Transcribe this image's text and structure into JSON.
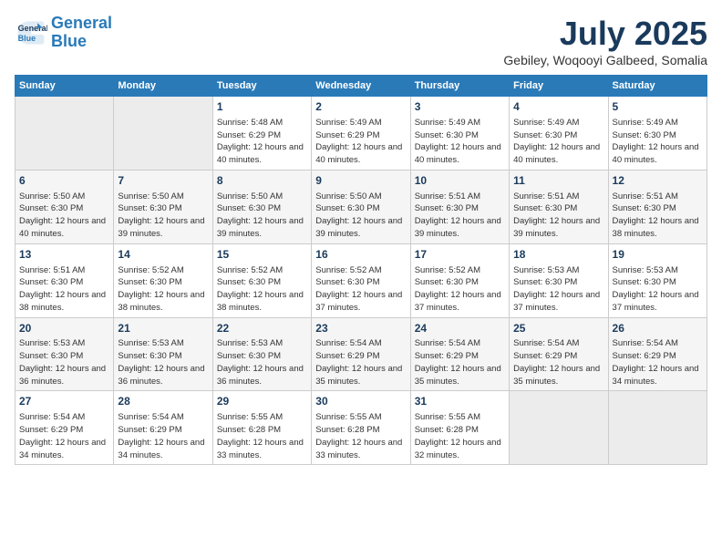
{
  "header": {
    "logo_line1": "General",
    "logo_line2": "Blue",
    "month": "July 2025",
    "location": "Gebiley, Woqooyi Galbeed, Somalia"
  },
  "weekdays": [
    "Sunday",
    "Monday",
    "Tuesday",
    "Wednesday",
    "Thursday",
    "Friday",
    "Saturday"
  ],
  "weeks": [
    [
      {
        "day": "",
        "info": ""
      },
      {
        "day": "",
        "info": ""
      },
      {
        "day": "1",
        "info": "Sunrise: 5:48 AM\nSunset: 6:29 PM\nDaylight: 12 hours and 40 minutes."
      },
      {
        "day": "2",
        "info": "Sunrise: 5:49 AM\nSunset: 6:29 PM\nDaylight: 12 hours and 40 minutes."
      },
      {
        "day": "3",
        "info": "Sunrise: 5:49 AM\nSunset: 6:30 PM\nDaylight: 12 hours and 40 minutes."
      },
      {
        "day": "4",
        "info": "Sunrise: 5:49 AM\nSunset: 6:30 PM\nDaylight: 12 hours and 40 minutes."
      },
      {
        "day": "5",
        "info": "Sunrise: 5:49 AM\nSunset: 6:30 PM\nDaylight: 12 hours and 40 minutes."
      }
    ],
    [
      {
        "day": "6",
        "info": "Sunrise: 5:50 AM\nSunset: 6:30 PM\nDaylight: 12 hours and 40 minutes."
      },
      {
        "day": "7",
        "info": "Sunrise: 5:50 AM\nSunset: 6:30 PM\nDaylight: 12 hours and 39 minutes."
      },
      {
        "day": "8",
        "info": "Sunrise: 5:50 AM\nSunset: 6:30 PM\nDaylight: 12 hours and 39 minutes."
      },
      {
        "day": "9",
        "info": "Sunrise: 5:50 AM\nSunset: 6:30 PM\nDaylight: 12 hours and 39 minutes."
      },
      {
        "day": "10",
        "info": "Sunrise: 5:51 AM\nSunset: 6:30 PM\nDaylight: 12 hours and 39 minutes."
      },
      {
        "day": "11",
        "info": "Sunrise: 5:51 AM\nSunset: 6:30 PM\nDaylight: 12 hours and 39 minutes."
      },
      {
        "day": "12",
        "info": "Sunrise: 5:51 AM\nSunset: 6:30 PM\nDaylight: 12 hours and 38 minutes."
      }
    ],
    [
      {
        "day": "13",
        "info": "Sunrise: 5:51 AM\nSunset: 6:30 PM\nDaylight: 12 hours and 38 minutes."
      },
      {
        "day": "14",
        "info": "Sunrise: 5:52 AM\nSunset: 6:30 PM\nDaylight: 12 hours and 38 minutes."
      },
      {
        "day": "15",
        "info": "Sunrise: 5:52 AM\nSunset: 6:30 PM\nDaylight: 12 hours and 38 minutes."
      },
      {
        "day": "16",
        "info": "Sunrise: 5:52 AM\nSunset: 6:30 PM\nDaylight: 12 hours and 37 minutes."
      },
      {
        "day": "17",
        "info": "Sunrise: 5:52 AM\nSunset: 6:30 PM\nDaylight: 12 hours and 37 minutes."
      },
      {
        "day": "18",
        "info": "Sunrise: 5:53 AM\nSunset: 6:30 PM\nDaylight: 12 hours and 37 minutes."
      },
      {
        "day": "19",
        "info": "Sunrise: 5:53 AM\nSunset: 6:30 PM\nDaylight: 12 hours and 37 minutes."
      }
    ],
    [
      {
        "day": "20",
        "info": "Sunrise: 5:53 AM\nSunset: 6:30 PM\nDaylight: 12 hours and 36 minutes."
      },
      {
        "day": "21",
        "info": "Sunrise: 5:53 AM\nSunset: 6:30 PM\nDaylight: 12 hours and 36 minutes."
      },
      {
        "day": "22",
        "info": "Sunrise: 5:53 AM\nSunset: 6:30 PM\nDaylight: 12 hours and 36 minutes."
      },
      {
        "day": "23",
        "info": "Sunrise: 5:54 AM\nSunset: 6:29 PM\nDaylight: 12 hours and 35 minutes."
      },
      {
        "day": "24",
        "info": "Sunrise: 5:54 AM\nSunset: 6:29 PM\nDaylight: 12 hours and 35 minutes."
      },
      {
        "day": "25",
        "info": "Sunrise: 5:54 AM\nSunset: 6:29 PM\nDaylight: 12 hours and 35 minutes."
      },
      {
        "day": "26",
        "info": "Sunrise: 5:54 AM\nSunset: 6:29 PM\nDaylight: 12 hours and 34 minutes."
      }
    ],
    [
      {
        "day": "27",
        "info": "Sunrise: 5:54 AM\nSunset: 6:29 PM\nDaylight: 12 hours and 34 minutes."
      },
      {
        "day": "28",
        "info": "Sunrise: 5:54 AM\nSunset: 6:29 PM\nDaylight: 12 hours and 34 minutes."
      },
      {
        "day": "29",
        "info": "Sunrise: 5:55 AM\nSunset: 6:28 PM\nDaylight: 12 hours and 33 minutes."
      },
      {
        "day": "30",
        "info": "Sunrise: 5:55 AM\nSunset: 6:28 PM\nDaylight: 12 hours and 33 minutes."
      },
      {
        "day": "31",
        "info": "Sunrise: 5:55 AM\nSunset: 6:28 PM\nDaylight: 12 hours and 32 minutes."
      },
      {
        "day": "",
        "info": ""
      },
      {
        "day": "",
        "info": ""
      }
    ]
  ]
}
